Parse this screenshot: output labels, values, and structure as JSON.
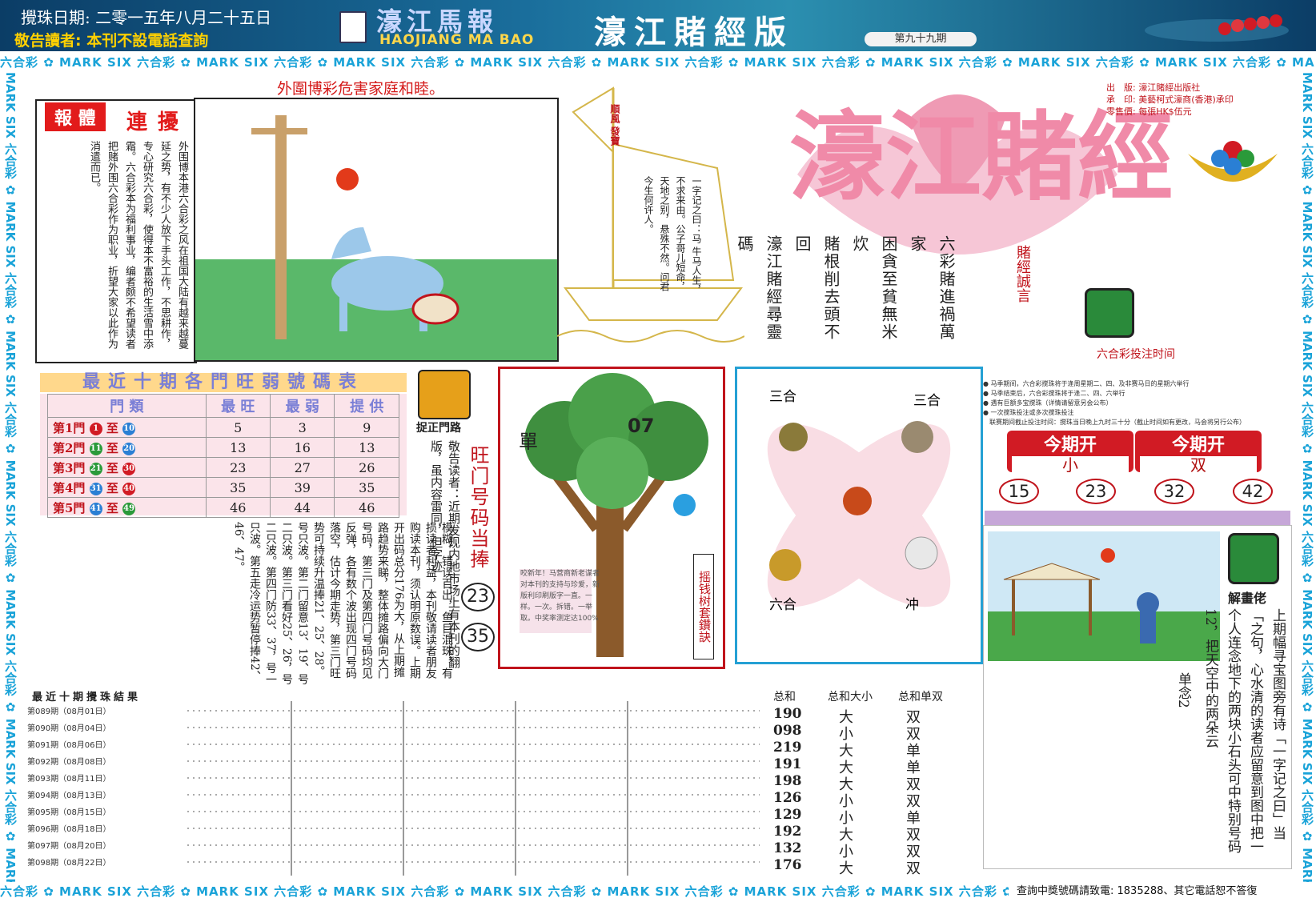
{
  "header": {
    "date": "攪珠日期: 二零一五年八月二十五日",
    "notice": "敬告讀者: 本刊不設電話查詢",
    "brand": "濠江馬報",
    "brand_en": "HAOJIANG MA BAO",
    "edition": "濠江賭經版",
    "issue": "第九十九期"
  },
  "banner_text": "六合彩 ✿ MARK SIX 六合彩 ✿ MARK SIX 六合彩 ✿ MARK SIX 六合彩 ✿ MARK SIX 六合彩 ✿ MARK SIX 六合彩 ✿ MARK SIX 六合彩 ✿ MARK SIX 六合彩 ✿ MARK SIX 六合彩 ✿ MARK SIX 六合彩 ✿ MARK SIX",
  "banner_vertical": "MARK SIX 六合彩 ✿ MARK SIX 六合彩 ✿ MARK SIX 六合彩 ✿ MARK SIX 六合彩 ✿ MARK SIX 六合彩 ✿ MARK SIX 六合彩 ✿ MARK SIX 六合彩 ✿ MARK SIX 六合彩",
  "footer_contact": "查詢中獎號碼請致電: 1835288、其它電話恕不答復",
  "story": {
    "headline": "外圍博彩危害家庭和睦。",
    "title_a": "報 體",
    "title_b": "連 擾",
    "text": "外围博本港六合彩之风在祖国大陆有越来越蔓延之势，有不少人放下手头工作，不思耕作，专心研究六合彩，使得本不富裕的生活雪中添霜。六合彩本为福利事业，编者颇不希望读者把赌外围六合彩作为职业，折望大家以此作为消遣而已。"
  },
  "boat": {
    "flag": "順風 發寶",
    "poem": "一字记之曰：马 牛马人生，不求来由。公子哥儿短命，天地之别，悬殊不然。问君今生何许人。"
  },
  "title_logo": {
    "main": "濠江賭經",
    "motto": [
      "六彩賭進禍萬家",
      "困貪至貧無米炊",
      "賭根削去頭不回",
      "濠江賭經尋靈碼"
    ],
    "motto_label": "賭經誠言",
    "pub_info": [
      "出　版: 濠江賭經出版社",
      "承　印: 美藝柯式濠商(香港)承印",
      "零售價: 每張HK$伍元"
    ],
    "draw_time_label": "六合彩投注时间"
  },
  "stats_table": {
    "title": "最近十期各門旺弱號碼表",
    "headers": [
      "門 類",
      "最 旺",
      "最 弱",
      "提 供"
    ],
    "rows": [
      {
        "gate": "第1門",
        "from": "1",
        "to": "10",
        "c_from": "#d11b24",
        "c_to": "#2a7fd4",
        "hot": "5",
        "weak": "3",
        "pick": "9"
      },
      {
        "gate": "第2門",
        "from": "11",
        "to": "20",
        "c_from": "#2a9a3a",
        "c_to": "#2a7fd4",
        "hot": "13",
        "weak": "16",
        "pick": "13"
      },
      {
        "gate": "第3門",
        "from": "21",
        "to": "30",
        "c_from": "#2a9a3a",
        "c_to": "#d11b24",
        "hot": "23",
        "weak": "27",
        "pick": "26"
      },
      {
        "gate": "第4門",
        "from": "31",
        "to": "40",
        "c_from": "#2a7fd4",
        "c_to": "#d11b24",
        "hot": "35",
        "weak": "39",
        "pick": "35"
      },
      {
        "gate": "第5門",
        "from": "41",
        "to": "49",
        "c_from": "#2a7fd4",
        "c_to": "#2a9a3a",
        "hot": "46",
        "weak": "44",
        "pick": "46"
      }
    ]
  },
  "correct_gate": {
    "label": "捉正門路",
    "note": "敬告读者：近期发现内地市场上有本刊的翻版，虽内容雷同，但字迹",
    "hot_label": "旺门号码当捧",
    "hot_numbers": [
      "23",
      "35"
    ]
  },
  "analysis_text": "模糊，错误百出，鱼目混珠，有损读者利益，本刊敬请读者朋友购读本刊，须认明原数误。上期开出码总分176为大，从上期摊路趋势来睇，整体摊路偏向大门号码，第三门及第四门号码均见反弹，各有数个波出现四门号码落空，估计今期走势，第三门旺势可持续升温捧21、25、28。号只波。第二门留意13、19、号二只波。第三门看好25、26，号二只波。第四门防33、37，号一只波。第五走冷运势暂停捧42、46、47。",
  "tree": {
    "label_single": "單",
    "label_number": "07",
    "note": "咬新年！马营商新老谋者对本刊的支持与珍爱，新版利印刷版字一直。一样。一次。拆错。一举取。中奖率测定达100%",
    "side_label": "摇钱树套鑽訣"
  },
  "zodiac": {
    "top_left": "三合",
    "top_right": "三合",
    "bottom_left": "六合",
    "bottom_right": "冲"
  },
  "draw_info": {
    "rules": [
      "● 马季期间，六合彩搅珠将于逢周星期二、四、及非赛马日的星期六举行",
      "● 马季结束后，六合彩搅珠将于逢二、四、六举行",
      "● 遇有巨额多宝搅珠（详情请留意另会公布）",
      "● 一次搅珠投注或多次搅珠投注",
      "　联赛期间截止投注时间：搅珠当日晚上九时三十分（截止时间如有更改，马会将另行公布）"
    ],
    "card_1": {
      "title": "今期开",
      "value": "小"
    },
    "card_2": {
      "title": "今期开",
      "value": "双"
    },
    "numbers": [
      "15",
      "23",
      "32",
      "42"
    ]
  },
  "riddle": {
    "decode_label": "解畫佬",
    "text": "上期幅寻宝图旁有诗「一字记之曰」当「之句，心水清的读者应留意到图中把一个人连念地下的两块小石头可中特别号码12，把天空中的两朵云",
    "guess": "单念2"
  },
  "results": {
    "title": "最近十期攪珠結果",
    "total_headers": [
      "总和",
      "总和大小",
      "总和单双"
    ],
    "rows": [
      {
        "label": "第089期（08月01日）",
        "total": "190",
        "size": "大",
        "parity": "双"
      },
      {
        "label": "第090期（08月04日）",
        "total": "098",
        "size": "小",
        "parity": "双"
      },
      {
        "label": "第091期（08月06日）",
        "total": "219",
        "size": "大",
        "parity": "单"
      },
      {
        "label": "第092期（08月08日）",
        "total": "191",
        "size": "大",
        "parity": "单"
      },
      {
        "label": "第093期（08月11日）",
        "total": "198",
        "size": "大",
        "parity": "双"
      },
      {
        "label": "第094期（08月13日）",
        "total": "126",
        "size": "小",
        "parity": "双"
      },
      {
        "label": "第095期（08月15日）",
        "total": "129",
        "size": "小",
        "parity": "单"
      },
      {
        "label": "第096期（08月18日）",
        "total": "192",
        "size": "大",
        "parity": "双"
      },
      {
        "label": "第097期（08月20日）",
        "total": "132",
        "size": "小",
        "parity": "双"
      },
      {
        "label": "第098期（08月22日）",
        "total": "176",
        "size": "大",
        "parity": "双"
      }
    ],
    "ball_colors": {
      "red": "#d11b24",
      "blue": "#2a7fd4",
      "green": "#2a9a3a"
    }
  }
}
